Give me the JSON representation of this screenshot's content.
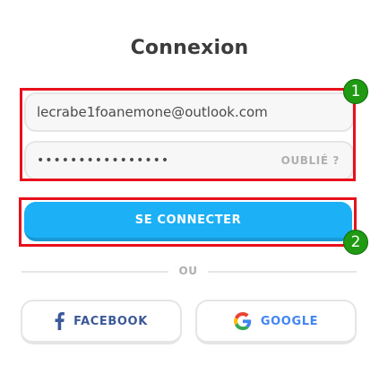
{
  "title": "Connexion",
  "email_field": {
    "value": "lecrabe1foanemone@outlook.com"
  },
  "password_field": {
    "value": "••••••••••••••••",
    "forgot_label": "OUBLIÉ ?"
  },
  "login_button": {
    "label": "SE CONNECTER"
  },
  "divider": {
    "label": "OU"
  },
  "social": {
    "facebook_label": "FACEBOOK",
    "google_label": "GOOGLE"
  },
  "annotations": {
    "badge_1": "1",
    "badge_2": "2"
  },
  "colors": {
    "accent": "#1cb0f6",
    "annotation_red": "#e8101d",
    "annotation_green": "#1f9a12",
    "facebook": "#3b5998",
    "google": "#4285f4"
  },
  "icons": {
    "facebook": "facebook-icon",
    "google": "google-icon"
  }
}
